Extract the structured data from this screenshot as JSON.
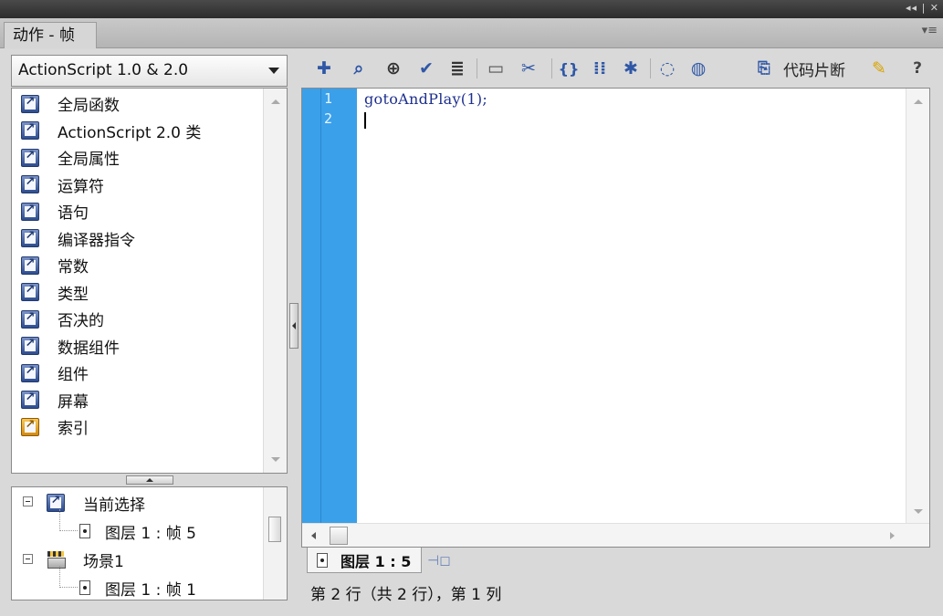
{
  "panel": {
    "tab_title": "动作 - 帧",
    "window_controls": "◂◂ | ✕",
    "menu_icon": "panel-menu-icon"
  },
  "toolbox": {
    "version_select": "ActionScript 1.0 & 2.0",
    "items": [
      {
        "label": "全局函数",
        "icon": "book-icon"
      },
      {
        "label": "ActionScript 2.0 类",
        "icon": "book-icon"
      },
      {
        "label": "全局属性",
        "icon": "book-icon"
      },
      {
        "label": "运算符",
        "icon": "book-icon"
      },
      {
        "label": "语句",
        "icon": "book-icon"
      },
      {
        "label": "编译器指令",
        "icon": "book-icon"
      },
      {
        "label": "常数",
        "icon": "book-icon"
      },
      {
        "label": "类型",
        "icon": "book-icon"
      },
      {
        "label": "否决的",
        "icon": "book-icon"
      },
      {
        "label": "数据组件",
        "icon": "book-icon"
      },
      {
        "label": "组件",
        "icon": "book-icon"
      },
      {
        "label": "屏幕",
        "icon": "book-icon"
      },
      {
        "label": "索引",
        "icon": "index-book-icon"
      }
    ]
  },
  "script_navigator": {
    "current_selection": "当前选择",
    "current_frame": "图层 1 : 帧 5",
    "scene": "场景1",
    "scene_frame": "图层 1 : 帧 1"
  },
  "toolbar": {
    "buttons": [
      {
        "name": "add-statement-icon",
        "glyph": "✚"
      },
      {
        "name": "find-icon",
        "glyph": "🔍"
      },
      {
        "name": "insert-target-path-icon",
        "glyph": "⊕"
      },
      {
        "name": "check-syntax-icon",
        "glyph": "✔"
      },
      {
        "name": "auto-format-icon",
        "glyph": "≣"
      },
      {
        "name": "show-code-hint-icon",
        "glyph": "💬"
      },
      {
        "name": "debug-options-icon",
        "glyph": "✂"
      },
      {
        "name": "collapse-between-braces-icon",
        "glyph": "{}"
      },
      {
        "name": "collapse-selection-icon",
        "glyph": "⋮⋮"
      },
      {
        "name": "expand-all-icon",
        "glyph": "✱"
      },
      {
        "name": "apply-block-comment-icon",
        "glyph": "💭"
      },
      {
        "name": "apply-line-comment-icon",
        "glyph": "🗨"
      }
    ],
    "snippets_label": "代码片断",
    "script_assist_icon": "magic-wand-icon",
    "help_icon": "help-icon"
  },
  "editor": {
    "lines": [
      {
        "no": "1",
        "code": "gotoAndPlay(1);"
      },
      {
        "no": "2",
        "code": ""
      }
    ]
  },
  "footer": {
    "layer_tab": "图层 1 : 5",
    "status": "第 2 行（共 2 行），第 1 列"
  },
  "colors": {
    "gutter": "#3aa0ea",
    "code_text": "#1d2f8e",
    "toolbar_icon": "#2f57a6"
  }
}
